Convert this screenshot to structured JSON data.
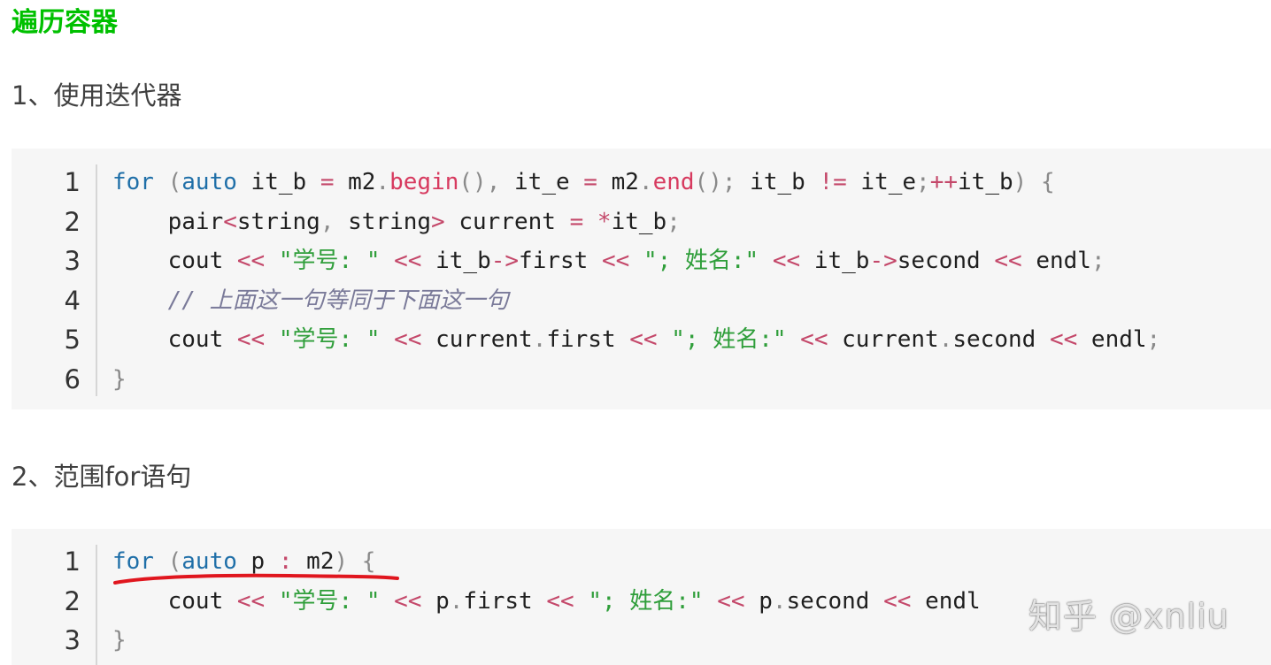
{
  "heading": "遍历容器",
  "section1": {
    "title": "1、使用迭代器",
    "numbers": [
      "1",
      "2",
      "3",
      "4",
      "5",
      "6"
    ],
    "lines": [
      [
        {
          "t": "for",
          "c": "kw"
        },
        {
          "t": " ",
          "c": ""
        },
        {
          "t": "(",
          "c": "punc"
        },
        {
          "t": "auto",
          "c": "kw"
        },
        {
          "t": " it_b ",
          "c": ""
        },
        {
          "t": "=",
          "c": "op"
        },
        {
          "t": " m2",
          "c": ""
        },
        {
          "t": ".",
          "c": "punc"
        },
        {
          "t": "begin",
          "c": "fn"
        },
        {
          "t": "(), ",
          "c": "punc"
        },
        {
          "t": "it_e ",
          "c": ""
        },
        {
          "t": "=",
          "c": "op"
        },
        {
          "t": " m2",
          "c": ""
        },
        {
          "t": ".",
          "c": "punc"
        },
        {
          "t": "end",
          "c": "fn"
        },
        {
          "t": "(); ",
          "c": "punc"
        },
        {
          "t": "it_b ",
          "c": ""
        },
        {
          "t": "!=",
          "c": "op"
        },
        {
          "t": " it_e",
          "c": ""
        },
        {
          "t": ";",
          "c": "punc"
        },
        {
          "t": "++",
          "c": "op"
        },
        {
          "t": "it_b",
          "c": ""
        },
        {
          "t": ") {",
          "c": "punc"
        }
      ],
      [
        {
          "t": "    pair",
          "c": ""
        },
        {
          "t": "<",
          "c": "op"
        },
        {
          "t": "string",
          "c": ""
        },
        {
          "t": ", ",
          "c": "punc"
        },
        {
          "t": "string",
          "c": ""
        },
        {
          "t": ">",
          "c": "op"
        },
        {
          "t": " current ",
          "c": ""
        },
        {
          "t": "=",
          "c": "op"
        },
        {
          "t": " ",
          "c": ""
        },
        {
          "t": "*",
          "c": "op"
        },
        {
          "t": "it_b",
          "c": ""
        },
        {
          "t": ";",
          "c": "punc"
        }
      ],
      [
        {
          "t": "    cout ",
          "c": ""
        },
        {
          "t": "<<",
          "c": "op"
        },
        {
          "t": " ",
          "c": ""
        },
        {
          "t": "\"学号: \"",
          "c": "str"
        },
        {
          "t": " ",
          "c": ""
        },
        {
          "t": "<<",
          "c": "op"
        },
        {
          "t": " it_b",
          "c": ""
        },
        {
          "t": "->",
          "c": "op"
        },
        {
          "t": "first ",
          "c": ""
        },
        {
          "t": "<<",
          "c": "op"
        },
        {
          "t": " ",
          "c": ""
        },
        {
          "t": "\"; 姓名:\"",
          "c": "str"
        },
        {
          "t": " ",
          "c": ""
        },
        {
          "t": "<<",
          "c": "op"
        },
        {
          "t": " it_b",
          "c": ""
        },
        {
          "t": "->",
          "c": "op"
        },
        {
          "t": "second ",
          "c": ""
        },
        {
          "t": "<<",
          "c": "op"
        },
        {
          "t": " endl",
          "c": ""
        },
        {
          "t": ";",
          "c": "punc"
        }
      ],
      [
        {
          "t": "    ",
          "c": ""
        },
        {
          "t": "// 上面这一句等同于下面这一句",
          "c": "cmt"
        }
      ],
      [
        {
          "t": "    cout ",
          "c": ""
        },
        {
          "t": "<<",
          "c": "op"
        },
        {
          "t": " ",
          "c": ""
        },
        {
          "t": "\"学号: \"",
          "c": "str"
        },
        {
          "t": " ",
          "c": ""
        },
        {
          "t": "<<",
          "c": "op"
        },
        {
          "t": " current",
          "c": ""
        },
        {
          "t": ".",
          "c": "punc"
        },
        {
          "t": "first ",
          "c": ""
        },
        {
          "t": "<<",
          "c": "op"
        },
        {
          "t": " ",
          "c": ""
        },
        {
          "t": "\"; 姓名:\"",
          "c": "str"
        },
        {
          "t": " ",
          "c": ""
        },
        {
          "t": "<<",
          "c": "op"
        },
        {
          "t": " current",
          "c": ""
        },
        {
          "t": ".",
          "c": "punc"
        },
        {
          "t": "second ",
          "c": ""
        },
        {
          "t": "<<",
          "c": "op"
        },
        {
          "t": " endl",
          "c": ""
        },
        {
          "t": ";",
          "c": "punc"
        }
      ],
      [
        {
          "t": "}",
          "c": "punc"
        }
      ]
    ]
  },
  "section2": {
    "title": "2、范围for语句",
    "numbers": [
      "1",
      "2",
      "3"
    ],
    "lines": [
      [
        {
          "t": "for",
          "c": "kw"
        },
        {
          "t": " ",
          "c": ""
        },
        {
          "t": "(",
          "c": "punc"
        },
        {
          "t": "auto",
          "c": "kw"
        },
        {
          "t": " p ",
          "c": ""
        },
        {
          "t": ":",
          "c": "op"
        },
        {
          "t": " m2",
          "c": ""
        },
        {
          "t": ") {",
          "c": "punc"
        }
      ],
      [
        {
          "t": "    cout ",
          "c": ""
        },
        {
          "t": "<<",
          "c": "op"
        },
        {
          "t": " ",
          "c": ""
        },
        {
          "t": "\"学号: \"",
          "c": "str"
        },
        {
          "t": " ",
          "c": ""
        },
        {
          "t": "<<",
          "c": "op"
        },
        {
          "t": " p",
          "c": ""
        },
        {
          "t": ".",
          "c": "punc"
        },
        {
          "t": "first ",
          "c": ""
        },
        {
          "t": "<<",
          "c": "op"
        },
        {
          "t": " ",
          "c": ""
        },
        {
          "t": "\"; 姓名:\"",
          "c": "str"
        },
        {
          "t": " ",
          "c": ""
        },
        {
          "t": "<<",
          "c": "op"
        },
        {
          "t": " p",
          "c": ""
        },
        {
          "t": ".",
          "c": "punc"
        },
        {
          "t": "second ",
          "c": ""
        },
        {
          "t": "<<",
          "c": "op"
        },
        {
          "t": " endl",
          "c": ""
        }
      ],
      [
        {
          "t": "}",
          "c": "punc"
        }
      ]
    ]
  },
  "watermark": "知乎 @xnliu",
  "colors": {
    "heading": "#00c000",
    "keyword": "#1f6fa8",
    "function": "#d73a5f",
    "string": "#2f9e3a",
    "operator": "#c4486a",
    "comment": "#7a7a99",
    "annotation_underline": "#e0161e",
    "code_background": "#f6f6f6"
  }
}
